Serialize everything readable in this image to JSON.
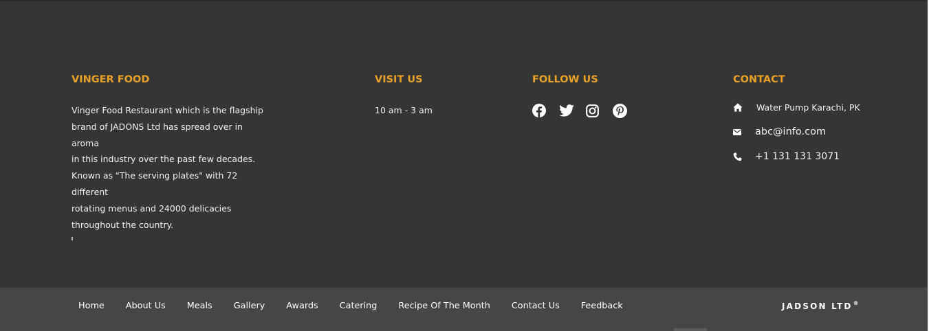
{
  "about": {
    "title": "VINGER FOOD",
    "lines": [
      "Vinger Food Restaurant which is the flagship",
      "brand of JADONS Ltd has spread over in aroma",
      "in this industry over the past few decades.",
      "Known as \"The serving plates\" with 72 different",
      "rotating menus and 24000 delicacies",
      "throughout the country."
    ]
  },
  "visit": {
    "title": "VISIT US",
    "hours": "10 am - 3 am"
  },
  "follow": {
    "title": "FOLLOW US",
    "icons": [
      "facebook-icon",
      "twitter-icon",
      "instagram-icon",
      "pinterest-icon"
    ]
  },
  "contact": {
    "title": "CONTACT",
    "address": "Water Pump Karachi, PK",
    "email": "abc@info.com",
    "phone": "+1 131 131 3071"
  },
  "nav": {
    "items": [
      "Home",
      "About Us",
      "Meals",
      "Gallery",
      "Awards",
      "Catering",
      "Recipe Of The Month",
      "Contact Us",
      "Feedback"
    ]
  },
  "brand": {
    "name": "JADSON LTD",
    "mark": "®"
  },
  "colors": {
    "background": "#353535",
    "bar": "#464646",
    "accent": "#e8a128",
    "text": "#f1f1f1"
  }
}
